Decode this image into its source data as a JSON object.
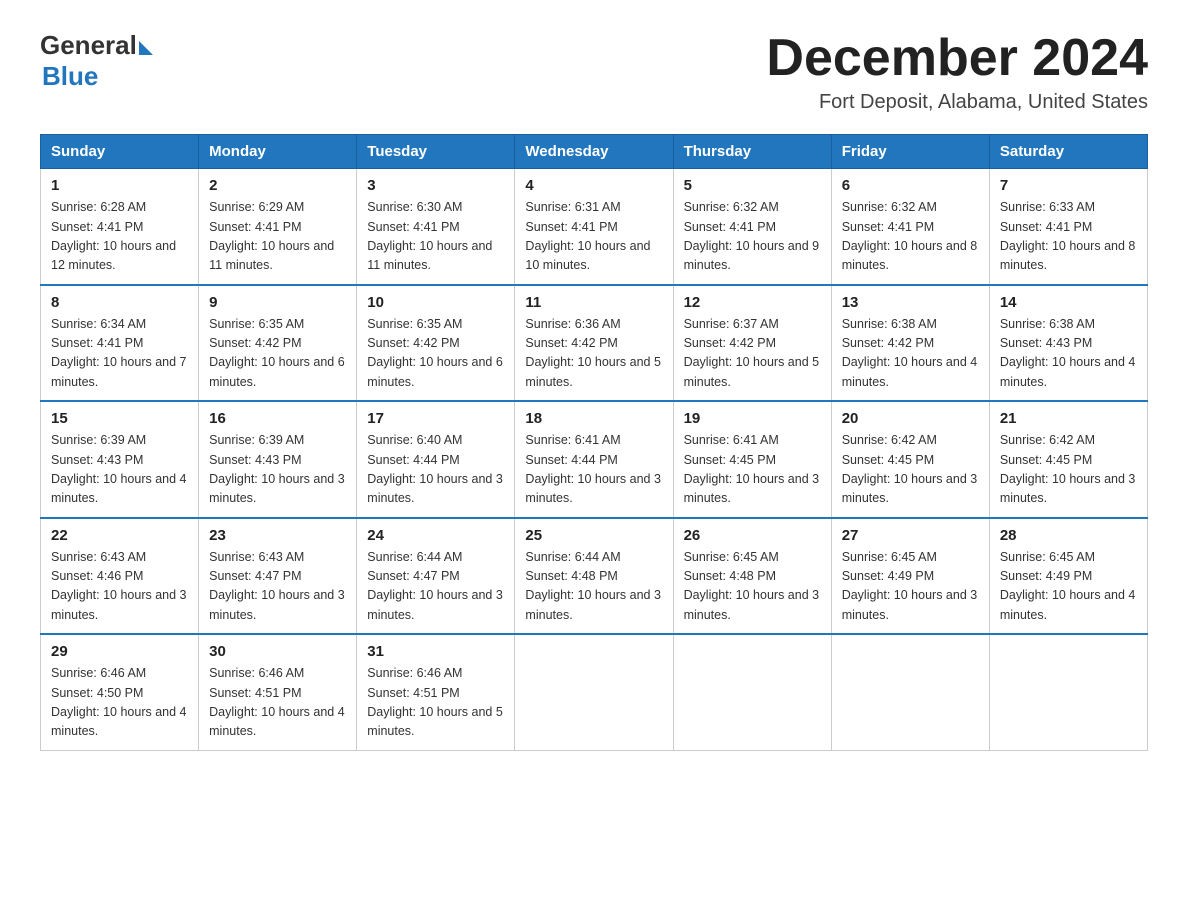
{
  "logo": {
    "general": "General",
    "blue": "Blue"
  },
  "title": "December 2024",
  "location": "Fort Deposit, Alabama, United States",
  "weekdays": [
    "Sunday",
    "Monday",
    "Tuesday",
    "Wednesday",
    "Thursday",
    "Friday",
    "Saturday"
  ],
  "weeks": [
    [
      {
        "day": "1",
        "sunrise": "6:28 AM",
        "sunset": "4:41 PM",
        "daylight": "10 hours and 12 minutes."
      },
      {
        "day": "2",
        "sunrise": "6:29 AM",
        "sunset": "4:41 PM",
        "daylight": "10 hours and 11 minutes."
      },
      {
        "day": "3",
        "sunrise": "6:30 AM",
        "sunset": "4:41 PM",
        "daylight": "10 hours and 11 minutes."
      },
      {
        "day": "4",
        "sunrise": "6:31 AM",
        "sunset": "4:41 PM",
        "daylight": "10 hours and 10 minutes."
      },
      {
        "day": "5",
        "sunrise": "6:32 AM",
        "sunset": "4:41 PM",
        "daylight": "10 hours and 9 minutes."
      },
      {
        "day": "6",
        "sunrise": "6:32 AM",
        "sunset": "4:41 PM",
        "daylight": "10 hours and 8 minutes."
      },
      {
        "day": "7",
        "sunrise": "6:33 AM",
        "sunset": "4:41 PM",
        "daylight": "10 hours and 8 minutes."
      }
    ],
    [
      {
        "day": "8",
        "sunrise": "6:34 AM",
        "sunset": "4:41 PM",
        "daylight": "10 hours and 7 minutes."
      },
      {
        "day": "9",
        "sunrise": "6:35 AM",
        "sunset": "4:42 PM",
        "daylight": "10 hours and 6 minutes."
      },
      {
        "day": "10",
        "sunrise": "6:35 AM",
        "sunset": "4:42 PM",
        "daylight": "10 hours and 6 minutes."
      },
      {
        "day": "11",
        "sunrise": "6:36 AM",
        "sunset": "4:42 PM",
        "daylight": "10 hours and 5 minutes."
      },
      {
        "day": "12",
        "sunrise": "6:37 AM",
        "sunset": "4:42 PM",
        "daylight": "10 hours and 5 minutes."
      },
      {
        "day": "13",
        "sunrise": "6:38 AM",
        "sunset": "4:42 PM",
        "daylight": "10 hours and 4 minutes."
      },
      {
        "day": "14",
        "sunrise": "6:38 AM",
        "sunset": "4:43 PM",
        "daylight": "10 hours and 4 minutes."
      }
    ],
    [
      {
        "day": "15",
        "sunrise": "6:39 AM",
        "sunset": "4:43 PM",
        "daylight": "10 hours and 4 minutes."
      },
      {
        "day": "16",
        "sunrise": "6:39 AM",
        "sunset": "4:43 PM",
        "daylight": "10 hours and 3 minutes."
      },
      {
        "day": "17",
        "sunrise": "6:40 AM",
        "sunset": "4:44 PM",
        "daylight": "10 hours and 3 minutes."
      },
      {
        "day": "18",
        "sunrise": "6:41 AM",
        "sunset": "4:44 PM",
        "daylight": "10 hours and 3 minutes."
      },
      {
        "day": "19",
        "sunrise": "6:41 AM",
        "sunset": "4:45 PM",
        "daylight": "10 hours and 3 minutes."
      },
      {
        "day": "20",
        "sunrise": "6:42 AM",
        "sunset": "4:45 PM",
        "daylight": "10 hours and 3 minutes."
      },
      {
        "day": "21",
        "sunrise": "6:42 AM",
        "sunset": "4:45 PM",
        "daylight": "10 hours and 3 minutes."
      }
    ],
    [
      {
        "day": "22",
        "sunrise": "6:43 AM",
        "sunset": "4:46 PM",
        "daylight": "10 hours and 3 minutes."
      },
      {
        "day": "23",
        "sunrise": "6:43 AM",
        "sunset": "4:47 PM",
        "daylight": "10 hours and 3 minutes."
      },
      {
        "day": "24",
        "sunrise": "6:44 AM",
        "sunset": "4:47 PM",
        "daylight": "10 hours and 3 minutes."
      },
      {
        "day": "25",
        "sunrise": "6:44 AM",
        "sunset": "4:48 PM",
        "daylight": "10 hours and 3 minutes."
      },
      {
        "day": "26",
        "sunrise": "6:45 AM",
        "sunset": "4:48 PM",
        "daylight": "10 hours and 3 minutes."
      },
      {
        "day": "27",
        "sunrise": "6:45 AM",
        "sunset": "4:49 PM",
        "daylight": "10 hours and 3 minutes."
      },
      {
        "day": "28",
        "sunrise": "6:45 AM",
        "sunset": "4:49 PM",
        "daylight": "10 hours and 4 minutes."
      }
    ],
    [
      {
        "day": "29",
        "sunrise": "6:46 AM",
        "sunset": "4:50 PM",
        "daylight": "10 hours and 4 minutes."
      },
      {
        "day": "30",
        "sunrise": "6:46 AM",
        "sunset": "4:51 PM",
        "daylight": "10 hours and 4 minutes."
      },
      {
        "day": "31",
        "sunrise": "6:46 AM",
        "sunset": "4:51 PM",
        "daylight": "10 hours and 5 minutes."
      },
      null,
      null,
      null,
      null
    ]
  ]
}
